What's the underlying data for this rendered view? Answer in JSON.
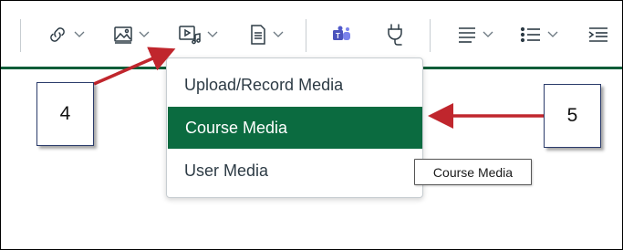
{
  "toolbar": {
    "buttons": [
      {
        "name": "link-icon",
        "has_chevron": true
      },
      {
        "name": "image-icon",
        "has_chevron": true
      },
      {
        "name": "media-icon",
        "has_chevron": true
      },
      {
        "name": "document-icon",
        "has_chevron": true
      },
      {
        "name": "teams-icon",
        "has_chevron": false
      },
      {
        "name": "plug-icon",
        "has_chevron": false
      },
      {
        "name": "align-icon",
        "has_chevron": true
      },
      {
        "name": "list-icon",
        "has_chevron": true
      },
      {
        "name": "indent-icon",
        "has_chevron": false
      }
    ],
    "accent_color": "#0b5d38"
  },
  "media_menu": {
    "items": [
      {
        "label": "Upload/Record Media",
        "active": false
      },
      {
        "label": "Course Media",
        "active": true
      },
      {
        "label": "User Media",
        "active": false
      }
    ],
    "active_color": "#0b6b40"
  },
  "tooltip": {
    "text": "Course Media"
  },
  "callouts": [
    {
      "label": "4",
      "arrow_color": "#c0262d"
    },
    {
      "label": "5",
      "arrow_color": "#c0262d"
    }
  ]
}
